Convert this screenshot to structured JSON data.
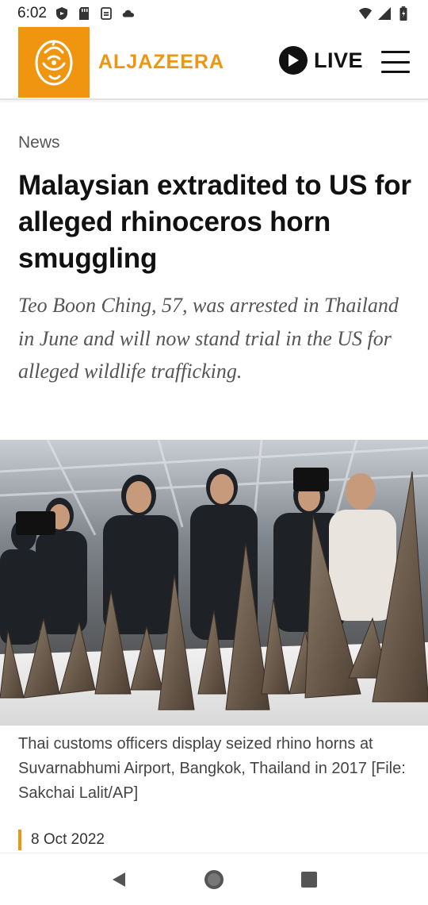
{
  "status_bar": {
    "time": "6:02",
    "left_icons": [
      "shield-icon",
      "sd-card-icon",
      "sync-icon",
      "cloud-icon"
    ],
    "right_icons": [
      "wifi-icon",
      "cell-signal-icon",
      "battery-icon"
    ]
  },
  "header": {
    "brand_name": "ALJAZEERA",
    "live_label": "LIVE",
    "brand_color": "#f0950f"
  },
  "article": {
    "category": "News",
    "headline": "Malaysian extradited to US for alleged rhinoceros horn smuggling",
    "standfirst": "Teo Boon Ching, 57, was arrested in Thailand in June and will now stand trial in the US for alleged wildlife trafficking.",
    "image_caption": "Thai customs officers display seized rhino horns at Suvarnabhumi Airport, Bangkok, Thailand in 2017 [File: Sakchai Lalit/AP]",
    "date": "8 Oct 2022"
  },
  "nav_bar": {
    "buttons": [
      "back-icon",
      "home-icon",
      "recents-icon"
    ]
  }
}
